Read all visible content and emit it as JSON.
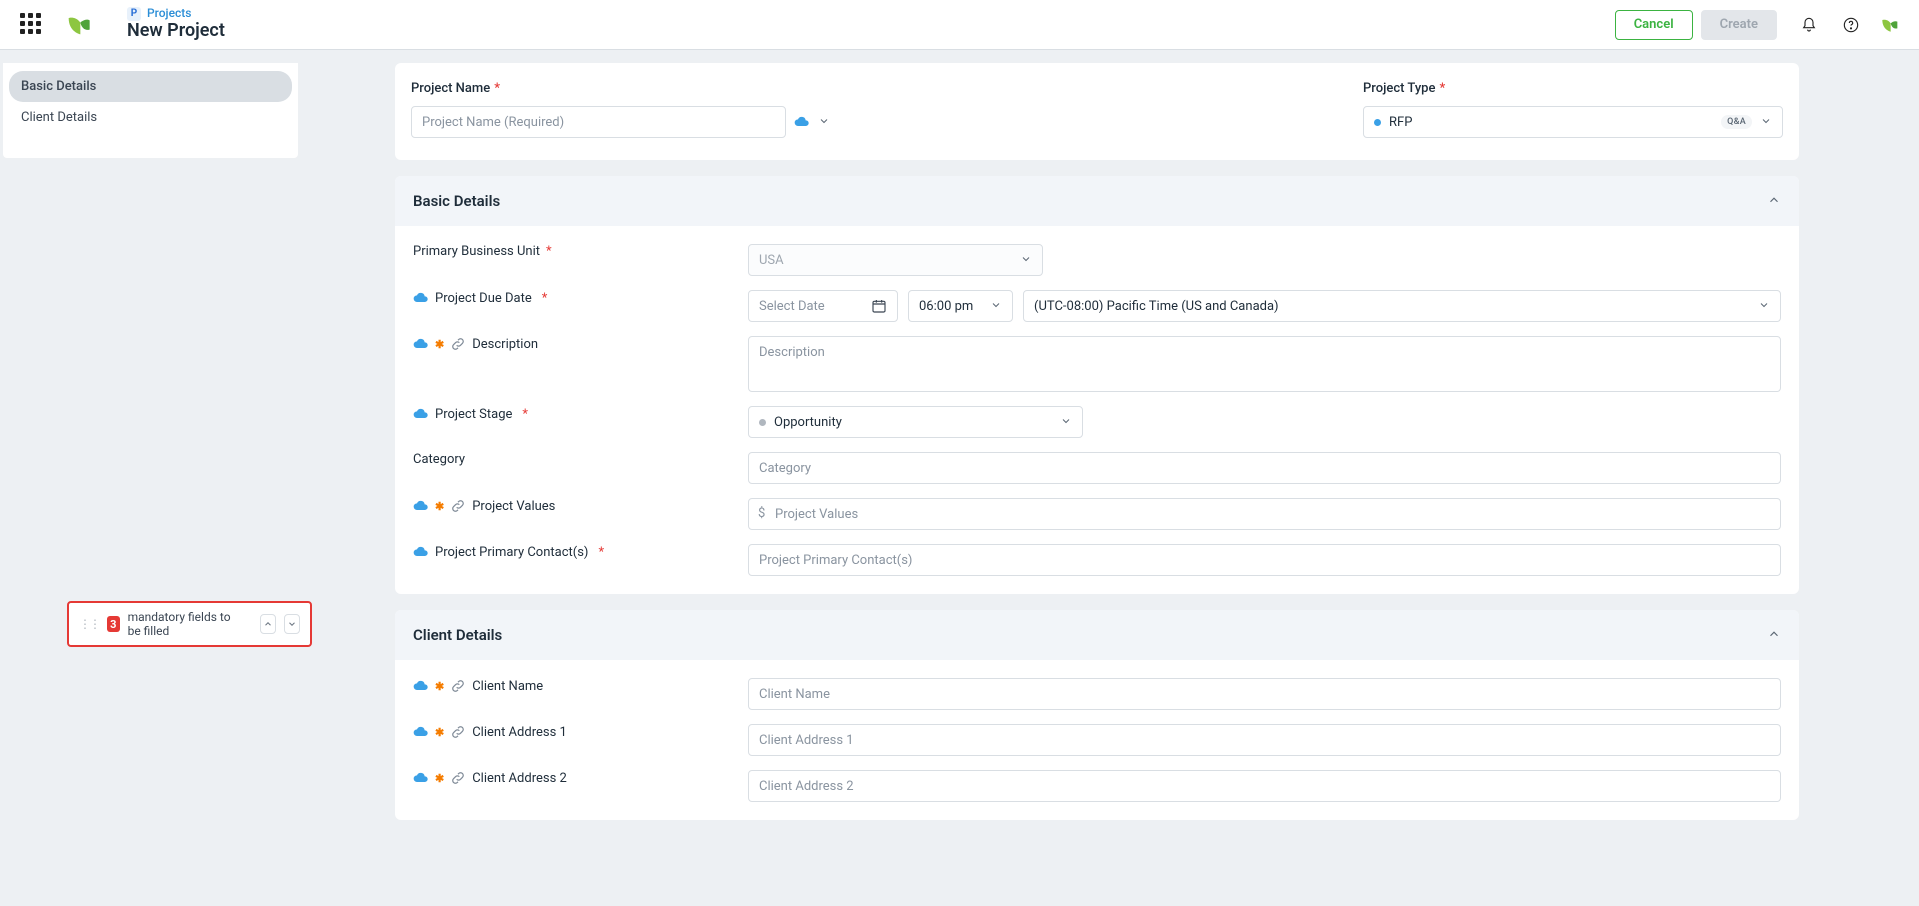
{
  "breadcrumb": {
    "section": "Projects",
    "title": "New Project"
  },
  "header": {
    "cancel": "Cancel",
    "create": "Create"
  },
  "sidebar": {
    "items": [
      "Basic Details",
      "Client Details"
    ],
    "active_index": 0
  },
  "top": {
    "pname_label": "Project Name",
    "pname_placeholder": "Project Name (Required)",
    "ptype_label": "Project Type",
    "ptype_value": "RFP",
    "ptype_badge": "Q&A"
  },
  "basic": {
    "title": "Basic Details",
    "pbu_label": "Primary Business Unit",
    "pbu_value": "USA",
    "due_label": "Project Due Date",
    "due_placeholder": "Select Date",
    "time_value": "06:00 pm",
    "tz_value": "(UTC-08:00) Pacific Time (US and Canada)",
    "desc_label": "Description",
    "desc_placeholder": "Description",
    "stage_label": "Project Stage",
    "stage_value": "Opportunity",
    "cat_label": "Category",
    "cat_placeholder": "Category",
    "vals_label": "Project Values",
    "vals_placeholder": "Project Values",
    "ppc_label": "Project Primary Contact(s)",
    "ppc_placeholder": "Project Primary Contact(s)"
  },
  "client": {
    "title": "Client Details",
    "name_label": "Client Name",
    "name_placeholder": "Client Name",
    "addr1_label": "Client Address 1",
    "addr1_placeholder": "Client Address 1",
    "addr2_label": "Client Address 2",
    "addr2_placeholder": "Client Address 2"
  },
  "mandatory": {
    "count": "3",
    "text": "mandatory fields to be filled"
  }
}
